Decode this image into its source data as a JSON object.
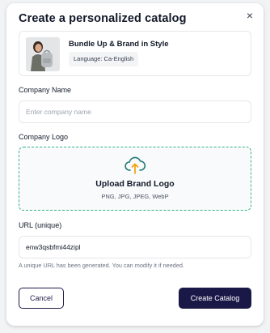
{
  "dialog": {
    "title": "Create a personalized catalog",
    "close_glyph": "×"
  },
  "product": {
    "name": "Bundle Up & Brand in Style",
    "language_badge": "Language: Ca-English",
    "thumbnail_icon": "person-with-backpack-image"
  },
  "company_name": {
    "label": "Company Name",
    "placeholder": "Enter company name",
    "value": ""
  },
  "company_logo": {
    "label": "Company Logo",
    "upload_title": "Upload Brand Logo",
    "formats": "PNG, JPG, JPEG, WebP",
    "icon": "cloud-upload-icon",
    "border_color": "#34b386"
  },
  "url": {
    "label": "URL (unique)",
    "value": "enw3qsbfmi44zipl",
    "helper": "A unique URL has been generated. You can modify it if needed."
  },
  "actions": {
    "cancel_label": "Cancel",
    "create_label": "Create Catalog",
    "primary_color": "#1a1847"
  }
}
